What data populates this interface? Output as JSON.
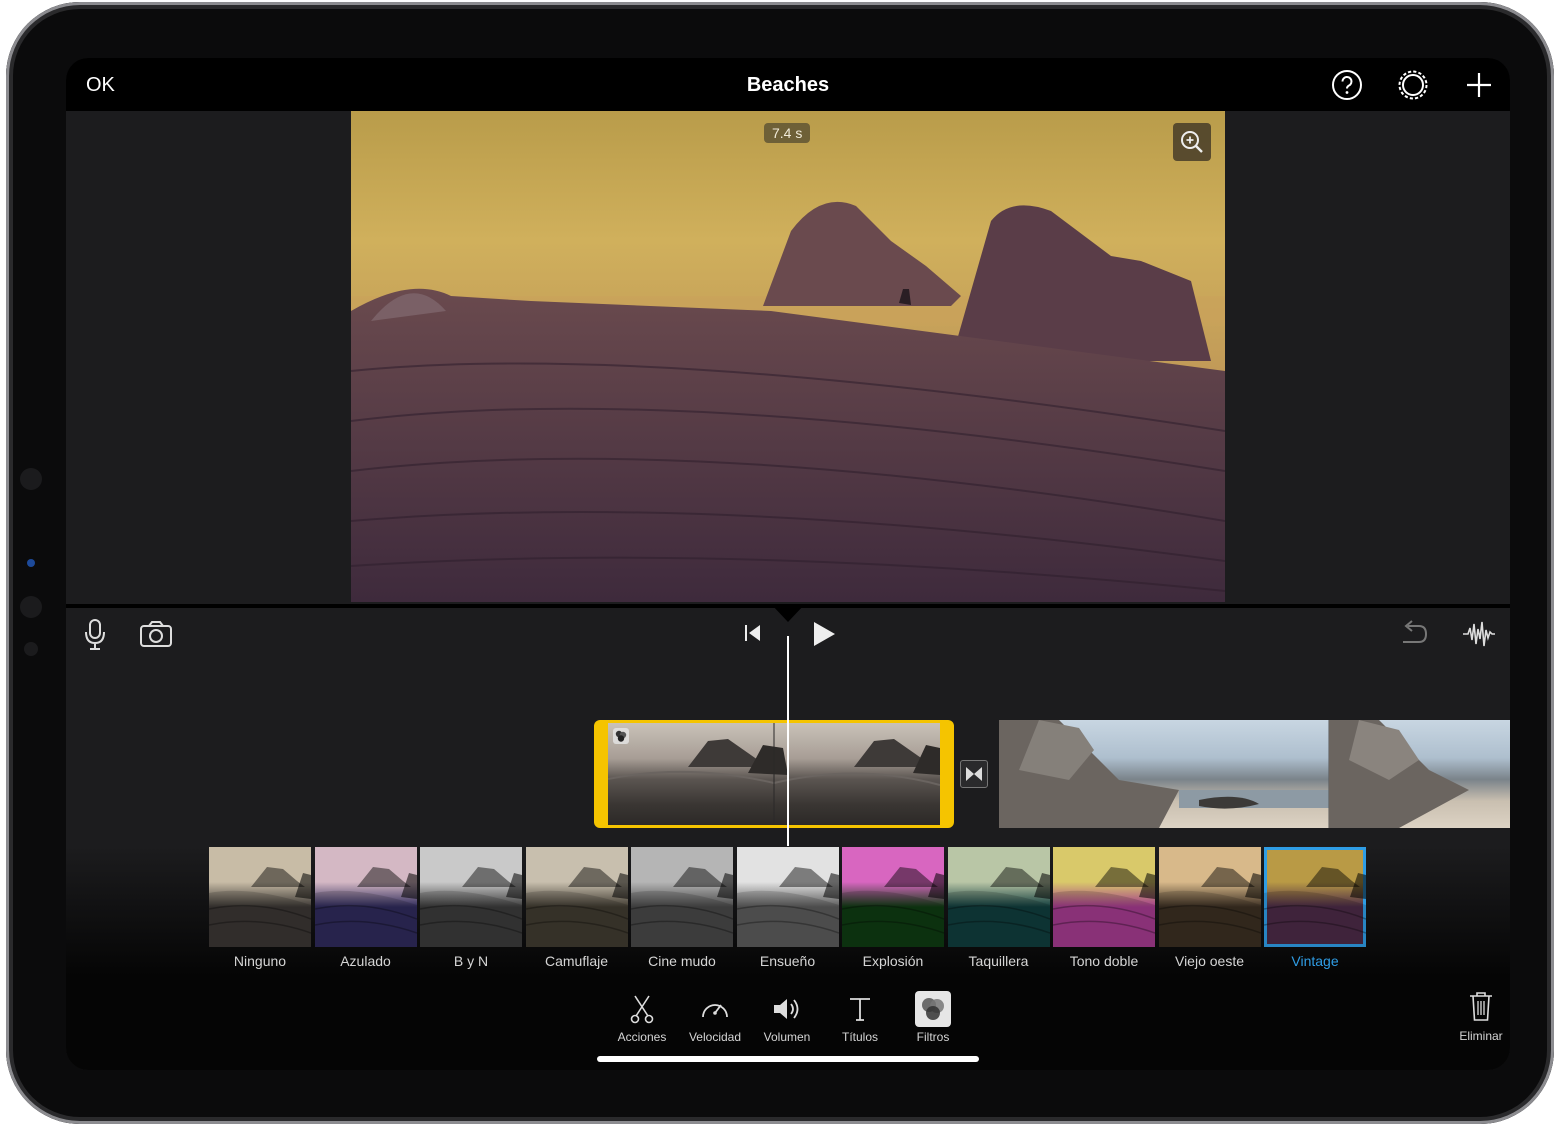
{
  "topbar": {
    "ok_label": "OK",
    "title": "Beaches"
  },
  "viewer": {
    "duration": "7.4 s"
  },
  "filters": [
    {
      "label": "Ninguno",
      "tint": [
        "#c8bca6",
        "#3a3633"
      ]
    },
    {
      "label": "Azulado",
      "tint": [
        "#d4b8c4",
        "#2e2a5a"
      ]
    },
    {
      "label": "B y N",
      "tint": [
        "#c9c9c9",
        "#3a3a3a"
      ]
    },
    {
      "label": "Camuflaje",
      "tint": [
        "#c8bfae",
        "#3f3a30"
      ]
    },
    {
      "label": "Cine mudo",
      "tint": [
        "#b5b5b5",
        "#474747"
      ]
    },
    {
      "label": "Ensueño",
      "tint": [
        "#e2e2e2",
        "#5a5a5a"
      ]
    },
    {
      "label": "Explosión",
      "tint": [
        "#d866c0",
        "#0f3a12"
      ]
    },
    {
      "label": "Taquillera",
      "tint": [
        "#b9c6a6",
        "#103c3c"
      ]
    },
    {
      "label": "Tono doble",
      "tint": [
        "#d9c96a",
        "#a23a8c"
      ]
    },
    {
      "label": "Viejo oeste",
      "tint": [
        "#d8b98a",
        "#3a2e22"
      ]
    },
    {
      "label": "Vintage",
      "tint": [
        "#b99a45",
        "#4a2a46"
      ]
    }
  ],
  "selected_filter": "Vintage",
  "toolbar": {
    "actions": "Acciones",
    "speed": "Velocidad",
    "volume": "Volumen",
    "titles": "Títulos",
    "filters": "Filtros",
    "delete": "Eliminar"
  }
}
